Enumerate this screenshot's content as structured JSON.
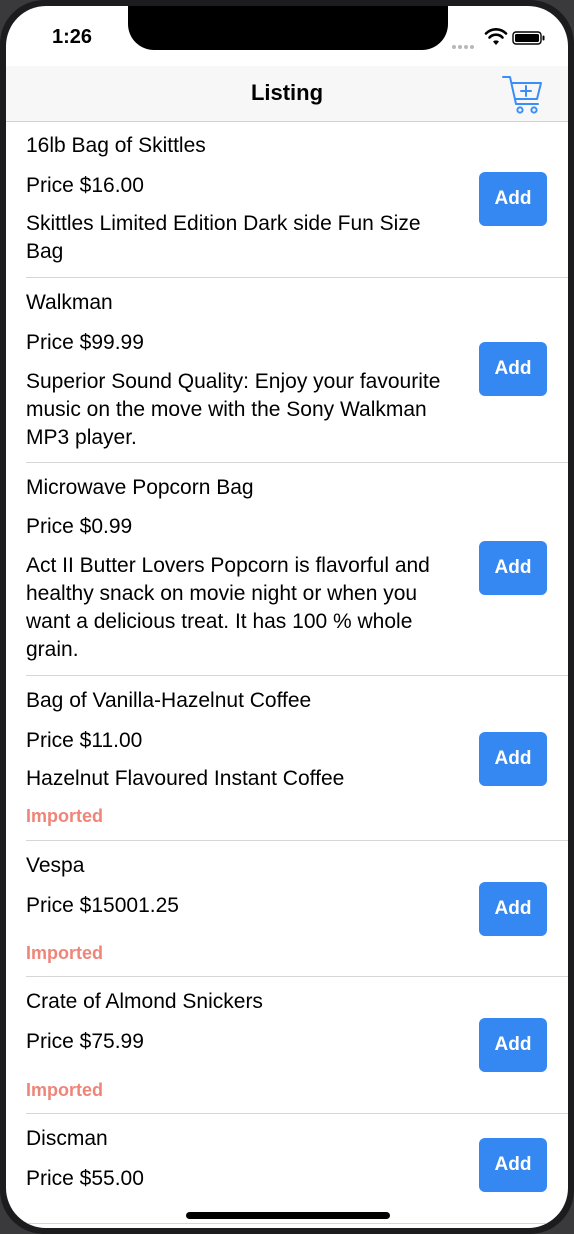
{
  "status": {
    "time": "1:26"
  },
  "nav": {
    "title": "Listing",
    "cart_icon": "cart-add-icon"
  },
  "colors": {
    "accent": "#3587f1",
    "imported": "#ef8579",
    "cart": "#3a8ff7"
  },
  "items": [
    {
      "name": "16lb Bag of Skittles",
      "price": "Price $16.00",
      "description": "Skittles Limited Edition Dark side Fun Size Bag",
      "add_label": "Add"
    },
    {
      "name": "Walkman",
      "price": "Price $99.99",
      "description": "Superior Sound Quality: Enjoy your favourite music on the move with the Sony Walkman MP3 player.",
      "add_label": "Add"
    },
    {
      "name": "Microwave Popcorn Bag",
      "price": "Price $0.99",
      "description": "Act II Butter Lovers Popcorn is flavorful and healthy snack on movie night or when you want a delicious treat. It has 100 % whole grain.",
      "add_label": "Add"
    },
    {
      "name": "Bag of Vanilla-Hazelnut Coffee",
      "price": "Price $11.00",
      "description": "Hazelnut Flavoured Instant Coffee",
      "imported": "Imported",
      "add_label": "Add"
    },
    {
      "name": "Vespa",
      "price": "Price $15001.25",
      "imported": "Imported",
      "add_label": "Add"
    },
    {
      "name": "Crate of Almond Snickers",
      "price": "Price $75.99",
      "imported": "Imported",
      "add_label": "Add"
    },
    {
      "name": "Discman",
      "price": "Price $55.00",
      "add_label": "Add"
    }
  ]
}
